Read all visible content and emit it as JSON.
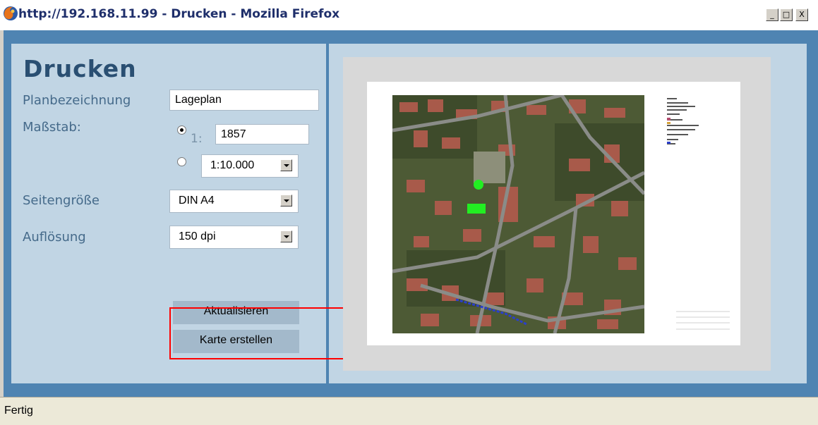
{
  "window": {
    "title": "http://192.168.11.99 - Drucken - Mozilla Firefox",
    "controls": {
      "minimize": "_",
      "maximize": "□",
      "close": "X"
    }
  },
  "form": {
    "heading": "Drucken",
    "planbezeichnung": {
      "label": "Planbezeichnung",
      "value": "Lageplan"
    },
    "massstab": {
      "label": "Maßstab:",
      "custom": {
        "prefix": "1:",
        "value": "1857",
        "selected": true
      },
      "preset": {
        "value": "1:10.000",
        "selected": false
      }
    },
    "seitengroesse": {
      "label": "Seitengröße",
      "value": "DIN A4"
    },
    "aufloesung": {
      "label": "Auflösung",
      "value": "150 dpi"
    },
    "buttons": {
      "aktualisieren": "Aktualisieren",
      "karte_erstellen": "Karte erstellen"
    }
  },
  "status": {
    "text": "Fertig"
  },
  "colors": {
    "panel": "#c1d5e4",
    "frame": "#4f84b2",
    "heading": "#2a4f72",
    "highlight": "#ff0000"
  }
}
